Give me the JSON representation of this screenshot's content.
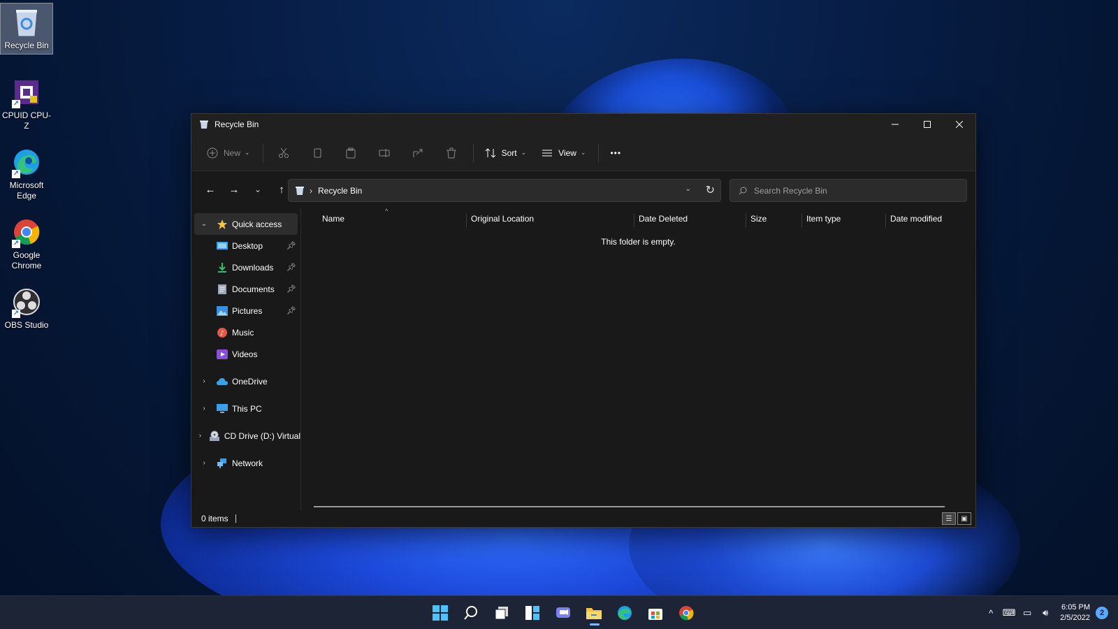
{
  "desktop": {
    "icons": [
      {
        "label": "Recycle Bin",
        "icon": "recycle-bin-icon"
      },
      {
        "label": "CPUID CPU-Z",
        "icon": "cpu-z-icon"
      },
      {
        "label": "Microsoft Edge",
        "icon": "edge-icon"
      },
      {
        "label": "Google Chrome",
        "icon": "chrome-icon"
      },
      {
        "label": "OBS Studio",
        "icon": "obs-icon"
      }
    ]
  },
  "window": {
    "title": "Recycle Bin",
    "toolbar": {
      "new_label": "New",
      "sort_label": "Sort",
      "view_label": "View",
      "more_label": "•••"
    },
    "address": {
      "separator": "›",
      "path": "Recycle Bin"
    },
    "search": {
      "placeholder": "Search Recycle Bin"
    },
    "sidebar": {
      "items": [
        {
          "label": "Quick access",
          "icon": "star-icon"
        },
        {
          "label": "Desktop",
          "icon": "desktop-icon",
          "pinned": true
        },
        {
          "label": "Downloads",
          "icon": "download-icon",
          "pinned": true
        },
        {
          "label": "Documents",
          "icon": "document-icon",
          "pinned": true
        },
        {
          "label": "Pictures",
          "icon": "pictures-icon",
          "pinned": true
        },
        {
          "label": "Music",
          "icon": "music-icon"
        },
        {
          "label": "Videos",
          "icon": "videos-icon"
        },
        {
          "label": "OneDrive",
          "icon": "cloud-icon"
        },
        {
          "label": "This PC",
          "icon": "pc-icon"
        },
        {
          "label": "CD Drive (D:) Virtual",
          "icon": "cd-drive-icon"
        },
        {
          "label": "Network",
          "icon": "network-icon"
        }
      ]
    },
    "columns": [
      "Name",
      "Original Location",
      "Date Deleted",
      "Size",
      "Item type",
      "Date modified"
    ],
    "empty_message": "This folder is empty.",
    "status": {
      "items_count": "0 items"
    }
  },
  "taskbar": {
    "apps": [
      "start-icon",
      "search-icon",
      "task-view-icon",
      "widgets-icon",
      "chat-icon",
      "file-explorer-icon",
      "edge-icon",
      "store-icon",
      "chrome-icon"
    ],
    "clock": {
      "time": "6:05 PM",
      "date": "2/5/2022"
    },
    "notifications": "2"
  },
  "colors": {
    "accent": "#5aa9ff",
    "window_bg": "#191919",
    "toolbar_bg": "#202020"
  }
}
